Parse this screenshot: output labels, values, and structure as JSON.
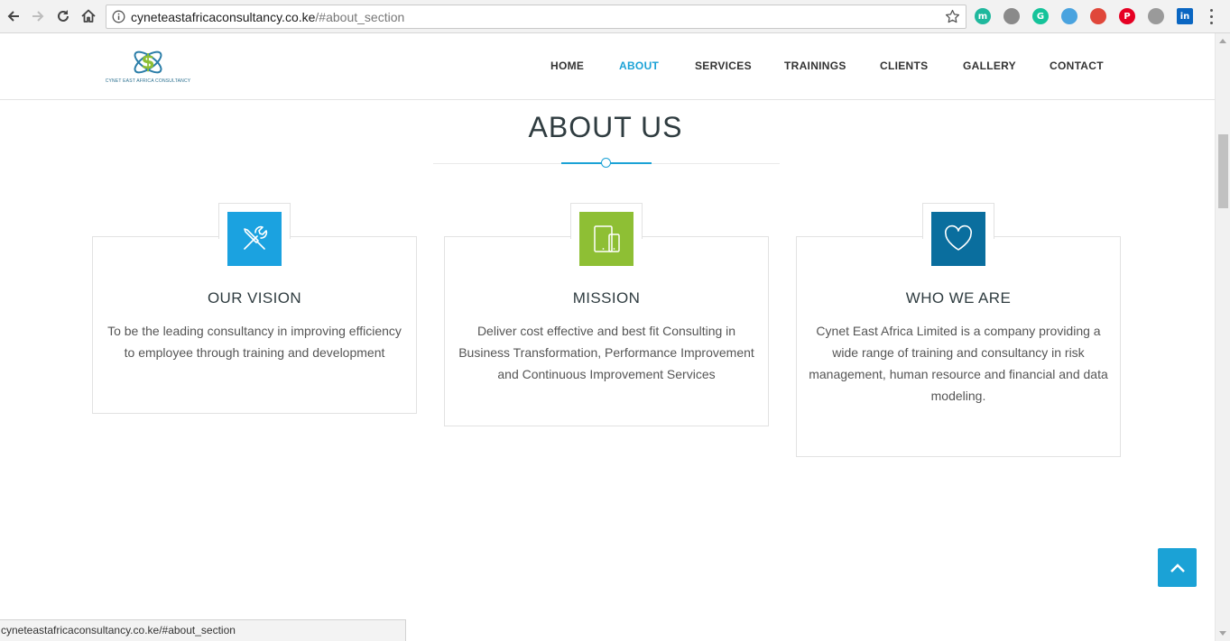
{
  "browser": {
    "url_domain": "cyneteastafricaconsultancy.co.ke",
    "url_path": "/#about_section",
    "status_url": "cyneteastafricaconsultancy.co.ke/#about_section",
    "icons": [
      "back-icon",
      "forward-icon",
      "reload-icon",
      "home-icon",
      "info-icon",
      "star-icon"
    ],
    "extensions": [
      {
        "name": "m",
        "color": "#1fb89d"
      },
      {
        "name": "",
        "color": "#8a8a8a"
      },
      {
        "name": "G",
        "color": "#15c39a"
      },
      {
        "name": "",
        "color": "#4aa3df"
      },
      {
        "name": "",
        "color": "#e0473a"
      },
      {
        "name": "P",
        "color": "#e60023"
      },
      {
        "name": "",
        "color": "#9a9a9a"
      },
      {
        "name": "in",
        "color": "#0a66c2"
      }
    ]
  },
  "site": {
    "logo_tagline": "CYNET EAST AFRICA CONSULTANCY",
    "nav": [
      {
        "label": "HOME",
        "active": false
      },
      {
        "label": "ABOUT",
        "active": true
      },
      {
        "label": "SERVICES",
        "active": false
      },
      {
        "label": "TRAININGS",
        "active": false
      },
      {
        "label": "CLIENTS",
        "active": false
      },
      {
        "label": "GALLERY",
        "active": false
      },
      {
        "label": "CONTACT",
        "active": false
      }
    ],
    "accent": "#1ba2d6"
  },
  "about": {
    "title": "ABOUT US",
    "cards": [
      {
        "title": "OUR VISION",
        "text": "To be the leading consultancy in improving efficiency to employee through training and development",
        "icon": "tools-icon",
        "icon_color": "#1ba2e0"
      },
      {
        "title": "MISSION",
        "text": "Deliver cost effective and best fit Consulting in Business Transformation, Performance Improvement and Continuous Improvement Services",
        "icon": "devices-icon",
        "icon_color": "#8ebf34"
      },
      {
        "title": "WHO WE ARE",
        "text": "Cynet East Africa Limited is a company providing a wide range of training and consultancy in risk management, human resource and financial and data modeling.",
        "icon": "heart-icon",
        "icon_color": "#0a6e9e"
      }
    ]
  }
}
